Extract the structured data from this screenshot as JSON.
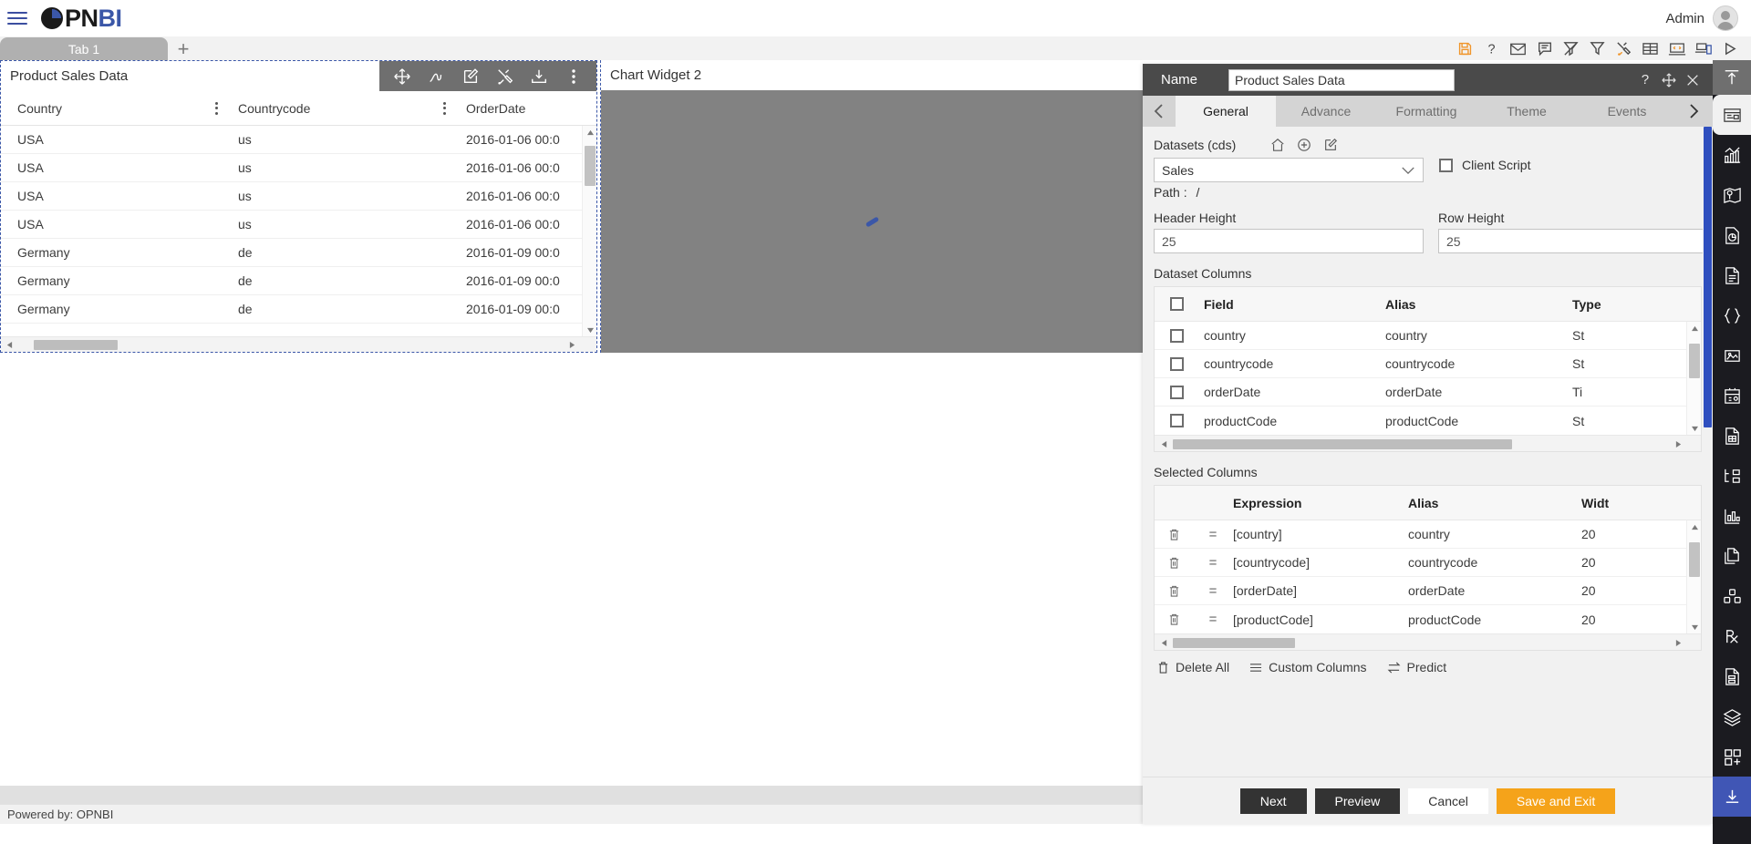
{
  "header": {
    "brand_pn": "PN",
    "brand_bi": "BI",
    "menu_icon": "hamburger-icon",
    "user_label": "Admin",
    "avatar_icon": "user-avatar-icon"
  },
  "tabbar": {
    "tabs": [
      {
        "label": "Tab 1"
      }
    ],
    "add_label": "+",
    "icons": [
      {
        "name": "save-icon",
        "title": "Save"
      },
      {
        "name": "help-icon",
        "title": "Help"
      },
      {
        "name": "mail-icon",
        "title": "Mail"
      },
      {
        "name": "comment-icon",
        "title": "Comment"
      },
      {
        "name": "clear-filter-icon",
        "title": "Clear Filter"
      },
      {
        "name": "filter-icon",
        "title": "Filter"
      },
      {
        "name": "tools-icon",
        "title": "Tools"
      },
      {
        "name": "table-icon",
        "title": "Table"
      },
      {
        "name": "code-icon",
        "title": "Code"
      },
      {
        "name": "responsive-icon",
        "title": "Responsive"
      },
      {
        "name": "play-icon",
        "title": "Run"
      }
    ]
  },
  "widgets": {
    "grid": {
      "title": "Product Sales Data",
      "toolbar_icons": [
        {
          "name": "move-icon"
        },
        {
          "name": "scribble-icon"
        },
        {
          "name": "edit-icon"
        },
        {
          "name": "tools-icon"
        },
        {
          "name": "download-icon"
        },
        {
          "name": "more-options-icon"
        }
      ],
      "columns": [
        "Country",
        "Countrycode",
        "OrderDate"
      ],
      "rows": [
        [
          "USA",
          "us",
          "2016-01-06 00:0"
        ],
        [
          "USA",
          "us",
          "2016-01-06 00:0"
        ],
        [
          "USA",
          "us",
          "2016-01-06 00:0"
        ],
        [
          "USA",
          "us",
          "2016-01-06 00:0"
        ],
        [
          "Germany",
          "de",
          "2016-01-09 00:0"
        ],
        [
          "Germany",
          "de",
          "2016-01-09 00:0"
        ],
        [
          "Germany",
          "de",
          "2016-01-09 00:0"
        ]
      ]
    },
    "chart": {
      "title": "Chart Widget 2",
      "state": "loading",
      "background_color": "#828282",
      "spinner_color": "#3b57a8"
    }
  },
  "panel": {
    "name_label": "Name",
    "name_value": "Product Sales Data",
    "header_icons": [
      {
        "name": "help-icon"
      },
      {
        "name": "move-icon"
      },
      {
        "name": "close-icon"
      }
    ],
    "tabs": [
      {
        "label": "General",
        "active": true
      },
      {
        "label": "Advance",
        "active": false
      },
      {
        "label": "Formatting",
        "active": false
      },
      {
        "label": "Theme",
        "active": false
      },
      {
        "label": "Events",
        "active": false
      }
    ],
    "prev_arrow": "chevron-left-icon",
    "next_arrow": "chevron-right-icon",
    "datasets_label": "Datasets (cds)",
    "datasets_icons": [
      {
        "name": "home-icon"
      },
      {
        "name": "add-circle-icon"
      },
      {
        "name": "edit-icon"
      }
    ],
    "dataset_value": "Sales",
    "client_script_label": "Client Script",
    "client_script_checked": false,
    "path_label": "Path :",
    "path_value": "/",
    "header_height_label": "Header Height",
    "header_height_value": "25",
    "row_height_label": "Row Height",
    "row_height_value": "25",
    "dataset_columns": {
      "title": "Dataset Columns",
      "headers": [
        "Field",
        "Alias",
        "Type"
      ],
      "rows": [
        {
          "field": "country",
          "alias": "country",
          "type": "St"
        },
        {
          "field": "countrycode",
          "alias": "countrycode",
          "type": "St"
        },
        {
          "field": "orderDate",
          "alias": "orderDate",
          "type": "Ti"
        },
        {
          "field": "productCode",
          "alias": "productCode",
          "type": "St"
        }
      ]
    },
    "selected_columns": {
      "title": "Selected Columns",
      "headers": [
        "Expression",
        "Alias",
        "Widt"
      ],
      "rows": [
        {
          "expression": "[country]",
          "alias": "country",
          "width": "20"
        },
        {
          "expression": "[countrycode]",
          "alias": "countrycode",
          "width": "20"
        },
        {
          "expression": "[orderDate]",
          "alias": "orderDate",
          "width": "20"
        },
        {
          "expression": "[productCode]",
          "alias": "productCode",
          "width": "20"
        }
      ]
    },
    "links": [
      {
        "label": "Delete All",
        "icon": "trash-icon"
      },
      {
        "label": "Custom Columns",
        "icon": "list-icon"
      },
      {
        "label": "Predict",
        "icon": "swap-icon"
      }
    ],
    "buttons": {
      "next": "Next",
      "preview": "Preview",
      "cancel": "Cancel",
      "save_exit": "Save and Exit"
    }
  },
  "right_rail": {
    "collapse_icon": "collapse-up-icon",
    "items": [
      {
        "name": "widget-icon",
        "selected": true
      },
      {
        "name": "chart-icon",
        "selected": false
      },
      {
        "name": "map-icon",
        "selected": false
      },
      {
        "name": "report-pie-icon",
        "selected": false
      },
      {
        "name": "document-icon",
        "selected": false
      },
      {
        "name": "braces-icon",
        "selected": false
      },
      {
        "name": "image-icon",
        "selected": false
      },
      {
        "name": "calendar-icon",
        "selected": false
      },
      {
        "name": "spreadsheet-icon",
        "selected": false
      },
      {
        "name": "tree-icon",
        "selected": false
      },
      {
        "name": "bar-stats-icon",
        "selected": false
      },
      {
        "name": "page-icon",
        "selected": false
      },
      {
        "name": "cubes-icon",
        "selected": false
      },
      {
        "name": "rx-icon",
        "selected": false
      },
      {
        "name": "form-icon",
        "selected": false
      },
      {
        "name": "layers-icon",
        "selected": false
      },
      {
        "name": "add-widget-icon",
        "selected": false
      },
      {
        "name": "download-icon",
        "accent": true
      }
    ]
  },
  "footer": {
    "text": "Powered by: OPNBI"
  },
  "colors": {
    "brand_blue": "#3b57a8",
    "accent_orange": "#f5a31a",
    "panel_header": "#4a4a4a",
    "rail_bg": "#1b1b20",
    "rail_accent": "#4056b5"
  }
}
